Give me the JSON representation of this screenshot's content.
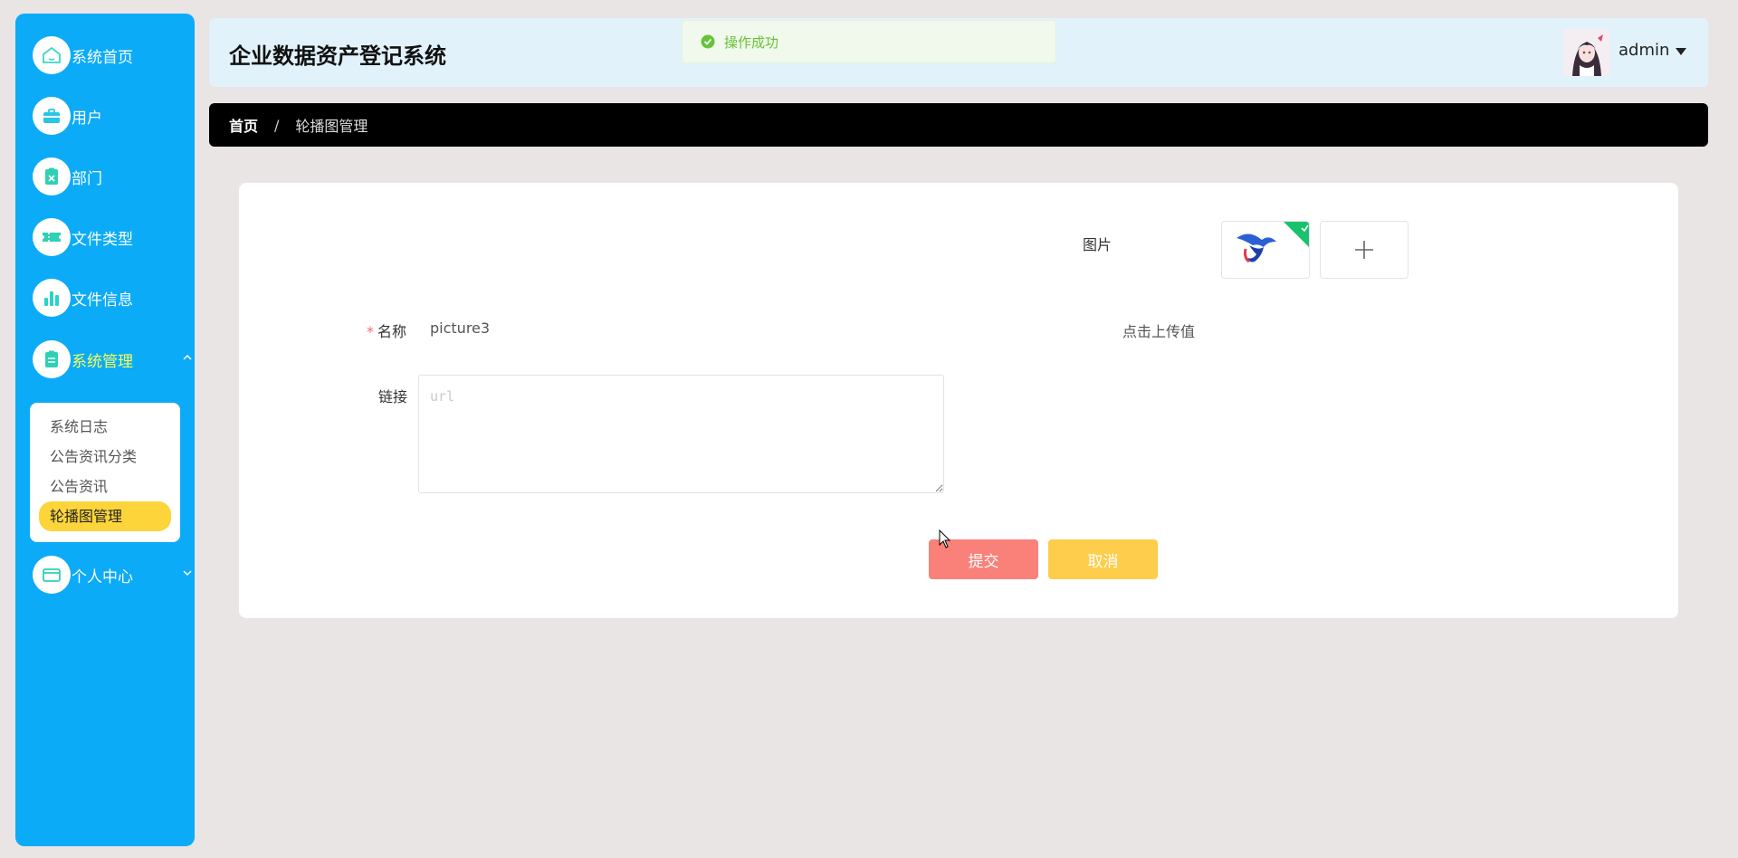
{
  "sidebar": {
    "items": [
      {
        "label": "系统首页",
        "icon": "home-icon"
      },
      {
        "label": "用户",
        "icon": "briefcase-icon"
      },
      {
        "label": "部门",
        "icon": "clipboard-x-icon"
      },
      {
        "label": "文件类型",
        "icon": "ticket-icon"
      },
      {
        "label": "文件信息",
        "icon": "bar-chart-icon"
      },
      {
        "label": "系统管理",
        "icon": "clipboard-icon",
        "expanded": true
      },
      {
        "label": "个人中心",
        "icon": "card-icon",
        "expanded": false
      }
    ],
    "submenu": [
      {
        "label": "系统日志"
      },
      {
        "label": "公告资讯分类"
      },
      {
        "label": "公告资讯"
      },
      {
        "label": "轮播图管理",
        "selected": true
      }
    ]
  },
  "header": {
    "title": "企业数据资产登记系统",
    "user": "admin"
  },
  "toast": {
    "text": "操作成功",
    "type": "success"
  },
  "breadcrumb": {
    "home": "首页",
    "separator": "/",
    "current": "轮播图管理"
  },
  "form": {
    "name_label": "名称",
    "name_required": "*",
    "name_value": "picture3",
    "link_label": "链接",
    "link_placeholder": "url",
    "image_label": "图片",
    "upload_hint": "点击上传值",
    "submit": "提交",
    "cancel": "取消"
  },
  "colors": {
    "sidebar_bg": "#0cabf8",
    "active_text": "#f5ff56",
    "selected_sub": "#fdd53a",
    "submit": "#f98179",
    "cancel": "#ffcd4c",
    "success": "#67c23a"
  }
}
